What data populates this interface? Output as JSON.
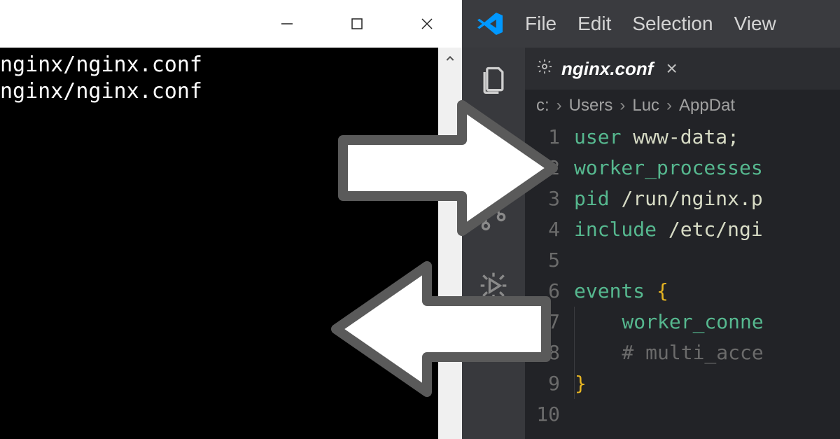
{
  "left": {
    "terminal_lines": [
      "nginx/nginx.conf",
      "nginx/nginx.conf"
    ]
  },
  "right": {
    "menu": {
      "file": "File",
      "edit": "Edit",
      "selection": "Selection",
      "view": "View"
    },
    "tab": {
      "title": "nginx.conf"
    },
    "breadcrumb": {
      "c": "c:",
      "users": "Users",
      "luc": "Luc",
      "appdata": "AppDat"
    },
    "editor": {
      "lines": [
        {
          "n": "1",
          "segs": [
            [
              "key",
              "user "
            ],
            [
              "id",
              "www-data"
            ],
            [
              "punct2",
              ";"
            ]
          ]
        },
        {
          "n": "2",
          "segs": [
            [
              "key",
              "worker_processes"
            ]
          ]
        },
        {
          "n": "3",
          "segs": [
            [
              "key",
              "pid "
            ],
            [
              "id",
              "/run/nginx.p"
            ]
          ]
        },
        {
          "n": "4",
          "segs": [
            [
              "key",
              "include "
            ],
            [
              "id",
              "/etc/ngi"
            ]
          ]
        },
        {
          "n": "5",
          "segs": []
        },
        {
          "n": "6",
          "segs": [
            [
              "key",
              "events "
            ],
            [
              "brace",
              "{"
            ]
          ]
        },
        {
          "n": "7",
          "segs": [
            [
              "indent",
              ""
            ],
            [
              "key",
              "    worker_conne"
            ]
          ]
        },
        {
          "n": "8",
          "segs": [
            [
              "indent",
              ""
            ],
            [
              "comment",
              "    # multi_acce"
            ]
          ]
        },
        {
          "n": "9",
          "segs": [
            [
              "indent",
              ""
            ],
            [
              "brace",
              "}"
            ]
          ]
        },
        {
          "n": "10",
          "segs": []
        }
      ]
    }
  }
}
